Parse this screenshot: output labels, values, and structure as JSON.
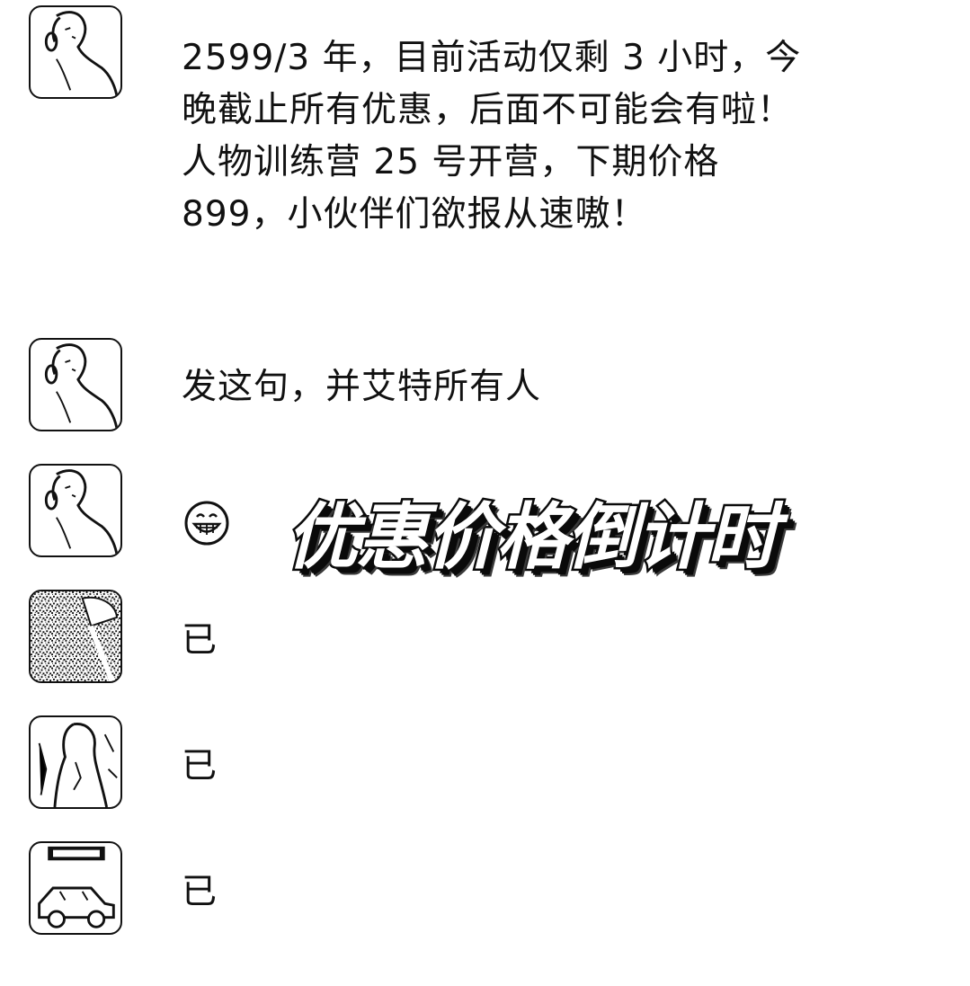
{
  "messages": [
    {
      "sender_icon": "woman-portrait-avatar",
      "text": "2599/3 年，目前活动仅剩 3 小时，今晚截止所有优惠，后面不可能会有啦！人物训练营 25 号开营，下期价格 899，小伙伴们欲报从速嗷！"
    },
    {
      "sender_icon": "woman-portrait-avatar",
      "text": "发这句，并艾特所有人"
    },
    {
      "sender_icon": "woman-portrait-avatar",
      "emoji": "grinning-face-icon"
    },
    {
      "sender_icon": "noisy-photo-avatar",
      "text": "已"
    },
    {
      "sender_icon": "girl-photo-avatar",
      "text": "已"
    },
    {
      "sender_icon": "car-illustration-avatar",
      "text": "已"
    }
  ],
  "overlay_title": "优惠价格倒计时"
}
